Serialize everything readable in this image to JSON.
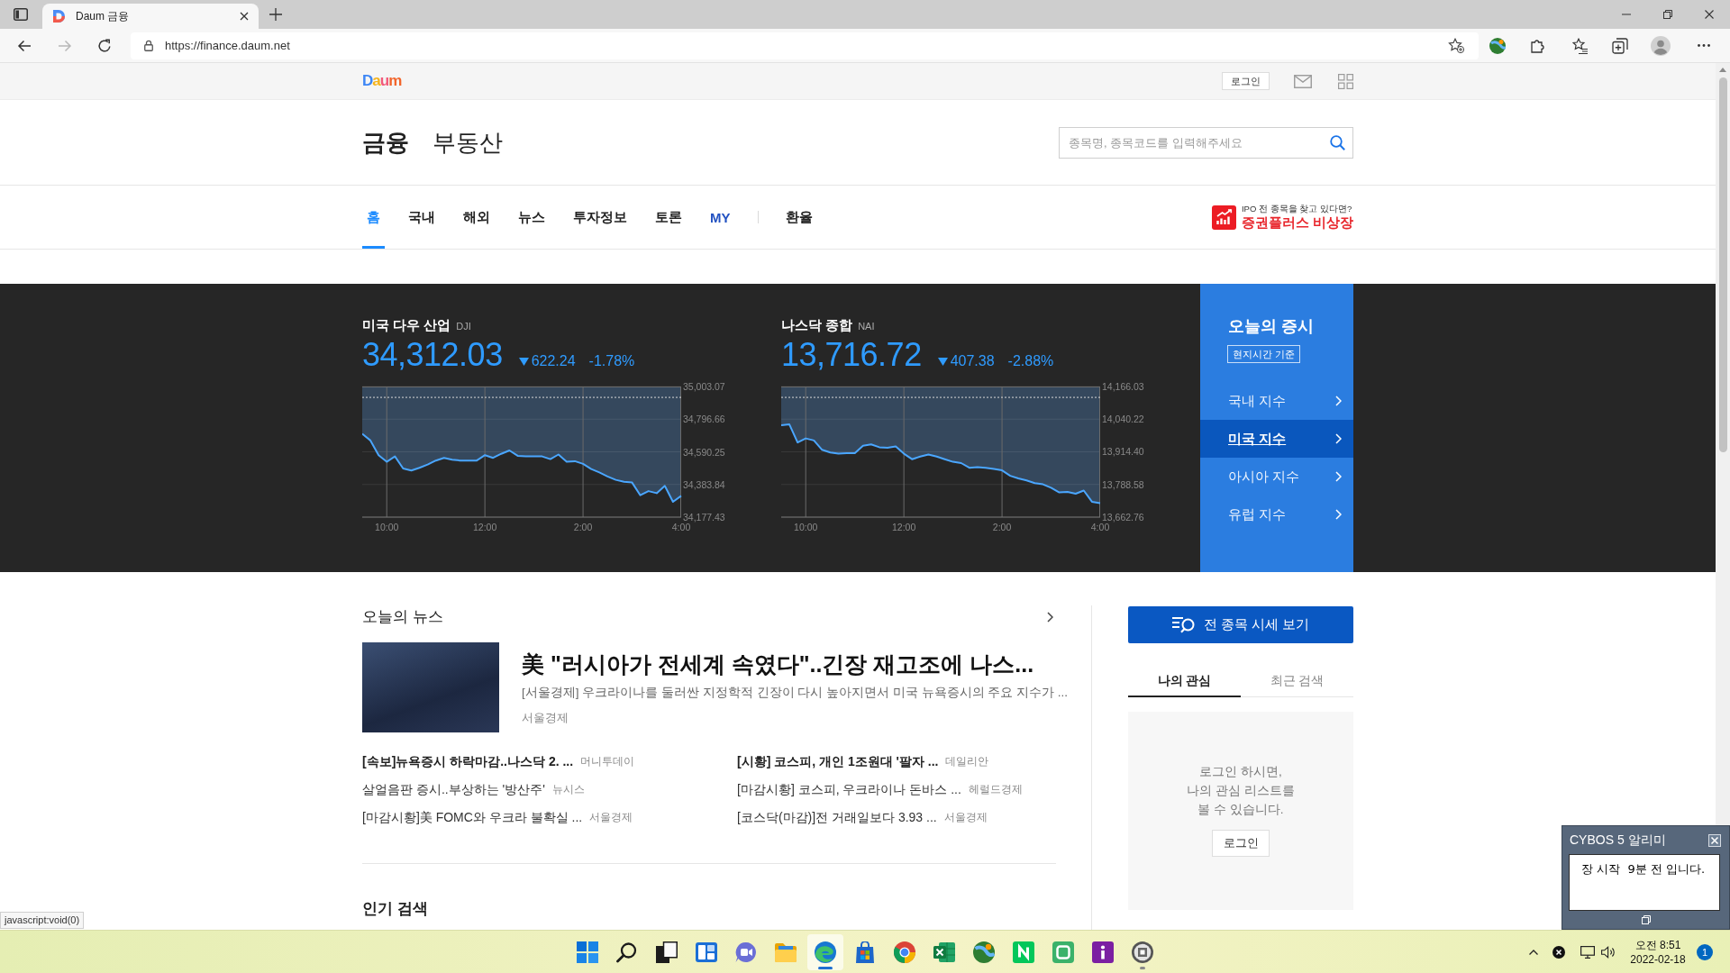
{
  "browser": {
    "tab_title": "Daum 금융",
    "url": "https://finance.daum.net",
    "forward_disabled": true,
    "status_text": "javascript:void(0)"
  },
  "top_bar": {
    "logo": "Daum",
    "login": "로그인"
  },
  "header": {
    "sections": [
      {
        "label": "금융",
        "selected": true
      },
      {
        "label": "부동산",
        "selected": false
      }
    ],
    "search": {
      "placeholder": "종목명, 종목코드를 입력해주세요"
    }
  },
  "nav": {
    "items": [
      {
        "label": "홈",
        "kind": "menu",
        "selected": true
      },
      {
        "label": "국내",
        "kind": "menu",
        "selected": false
      },
      {
        "label": "해외",
        "kind": "menu",
        "selected": false
      },
      {
        "label": "뉴스",
        "kind": "menu",
        "selected": false
      },
      {
        "label": "투자정보",
        "kind": "menu",
        "selected": false
      },
      {
        "label": "토론",
        "kind": "menu",
        "selected": false
      },
      {
        "label": "MY",
        "kind": "personal",
        "selected": false
      }
    ],
    "extra_items": [
      {
        "label": "환율",
        "selected": false
      }
    ]
  },
  "ad": {
    "tagline": "IPO 전 종목을 찾고 있다면?",
    "title": "증권플러스 비상장"
  },
  "indices": [
    {
      "name": "미국 다우 산업",
      "code": "DJI",
      "value": "34,312.03",
      "down": true,
      "change": "622.24",
      "rate": "-1.78%",
      "chart_data": {
        "type": "line",
        "categories": [
          null,
          null,
          null,
          "10:00",
          null,
          null,
          null,
          null,
          null,
          null,
          null,
          null,
          null,
          null,
          null,
          "12:00",
          null,
          null,
          null,
          null,
          null,
          null,
          null,
          null,
          null,
          null,
          null,
          "2:00",
          null,
          null,
          null,
          null,
          null,
          null,
          null,
          null,
          null,
          null,
          null,
          "4:00"
        ],
        "values": [
          34704,
          34662,
          34569,
          34527,
          34561,
          34485,
          34472,
          34489,
          34510,
          34535,
          34552,
          34540,
          34535,
          34535,
          34535,
          34569,
          34552,
          34578,
          34599,
          34565,
          34561,
          34561,
          34561,
          34544,
          34573,
          34527,
          34531,
          34514,
          34481,
          34460,
          34434,
          34413,
          34401,
          34396,
          34316,
          34342,
          34329,
          34375,
          34274,
          34312
        ],
        "ylim": [
          34177.43,
          35003.07
        ],
        "yticks": [
          {
            "value": 35003.07,
            "label": "35,003.07"
          },
          {
            "value": 34796.66,
            "label": "34,796.66"
          },
          {
            "value": 34590.25,
            "label": "34,590.25"
          },
          {
            "value": 34383.84,
            "label": "34,383.84"
          },
          {
            "value": 34177.43,
            "label": "34,177.43"
          }
        ],
        "grid": true,
        "ref_lines": [
          {
            "axis": "y",
            "value": 34934.27
          }
        ]
      }
    },
    {
      "name": "나스닥 종합",
      "code": "NAI",
      "value": "13,716.72",
      "down": true,
      "change": "407.38",
      "rate": "-2.88%",
      "chart_data": {
        "type": "line",
        "categories": [
          null,
          null,
          null,
          "10:00",
          null,
          null,
          null,
          null,
          null,
          null,
          null,
          null,
          null,
          null,
          null,
          "12:00",
          null,
          null,
          null,
          null,
          null,
          null,
          null,
          null,
          null,
          null,
          null,
          "2:00",
          null,
          null,
          null,
          null,
          null,
          null,
          null,
          null,
          null,
          null,
          null,
          "4:00"
        ],
        "values": [
          14017,
          14020,
          13950,
          13966,
          13958,
          13922,
          13912,
          13907,
          13909,
          13909,
          13938,
          13943,
          13932,
          13930,
          13935,
          13907,
          13886,
          13896,
          13904,
          13896,
          13886,
          13876,
          13871,
          13853,
          13855,
          13853,
          13848,
          13843,
          13822,
          13812,
          13804,
          13794,
          13789,
          13776,
          13758,
          13760,
          13753,
          13765,
          13722,
          13717
        ],
        "ylim": [
          13662.76,
          14166.03
        ],
        "yticks": [
          {
            "value": 14166.03,
            "label": "14,166.03"
          },
          {
            "value": 14040.22,
            "label": "14,040.22"
          },
          {
            "value": 13914.4,
            "label": "13,914.40"
          },
          {
            "value": 13788.58,
            "label": "13,788.58"
          },
          {
            "value": 13662.76,
            "label": "13,662.76"
          }
        ],
        "grid": true,
        "ref_lines": [
          {
            "axis": "y",
            "value": 14124.1
          }
        ]
      }
    }
  ],
  "market_panel": {
    "title": "오늘의 증시",
    "note": "현지시간 기준",
    "items": [
      {
        "label": "국내 지수",
        "selected": false
      },
      {
        "label": "미국 지수",
        "selected": true
      },
      {
        "label": "아시아 지수",
        "selected": false
      },
      {
        "label": "유럽 지수",
        "selected": false
      }
    ]
  },
  "news": {
    "title": "오늘의 뉴스",
    "featured": {
      "headline": "美 \"러시아가 전세계 속였다\"..긴장 재고조에 나스...",
      "summary": "[서울경제] 우크라이나를 둘러싼 지정학적 긴장이 다시 높아지면서 미국 뉴욕증시의 주요 지수가 ...",
      "source": "서울경제"
    },
    "items": [
      {
        "title": "[속보]뉴욕증시 하락마감..나스닥 2. ...",
        "source": "머니투데이",
        "bold": true
      },
      {
        "title": "살얼음판 증시..부상하는 '방산주'",
        "source": "뉴시스",
        "bold": false
      },
      {
        "title": "[마감시황]美 FOMC와 우크라 불확실 ...",
        "source": "서울경제",
        "bold": false
      },
      {
        "title": "[시황] 코스피, 개인 1조원대 '팔자 ...",
        "source": "데일리안",
        "bold": true
      },
      {
        "title": "[마감시황] 코스피, 우크라이나 돈바스 ...",
        "source": "헤럴드경제",
        "bold": false
      },
      {
        "title": "[코스닥(마감)]전 거래일보다 3.93 ...",
        "source": "서울경제",
        "bold": false
      }
    ]
  },
  "popular": {
    "title": "인기 검색"
  },
  "sidebar": {
    "all_quotes_button": "전 종목 시세 보기",
    "tabs": [
      {
        "label": "나의 관심",
        "selected": true
      },
      {
        "label": "최근 검색",
        "selected": false
      }
    ],
    "message": "로그인 하시면,\n나의 관심 리스트를\n볼 수 있습니다.",
    "login_button": "로그인"
  },
  "popup": {
    "title": "CYBOS 5 알리미",
    "message": "장 시작  9분 전 입니다."
  },
  "taskbar": {
    "apps": [
      {
        "kind": "start",
        "active": false,
        "running": false
      },
      {
        "kind": "search",
        "active": false,
        "running": false
      },
      {
        "kind": "task_view",
        "active": false,
        "running": false
      },
      {
        "kind": "widgets",
        "active": false,
        "running": false
      },
      {
        "kind": "chat",
        "active": false,
        "running": false
      },
      {
        "kind": "explorer",
        "active": false,
        "running": false
      },
      {
        "kind": "edge",
        "active": true,
        "running": true
      },
      {
        "kind": "store",
        "active": false,
        "running": false
      },
      {
        "kind": "chrome",
        "active": false,
        "running": false
      },
      {
        "kind": "excel",
        "active": false,
        "running": false
      },
      {
        "kind": "globe",
        "active": false,
        "running": false
      },
      {
        "kind": "naver",
        "active": false,
        "running": false
      },
      {
        "kind": "tile_app",
        "active": false,
        "running": false
      },
      {
        "kind": "info_app",
        "active": false,
        "running": false
      },
      {
        "kind": "disc_app",
        "active": false,
        "running": true
      }
    ],
    "clock": {
      "time": "오전 8:51",
      "date": "2022-02-18"
    },
    "notification_count": "1"
  }
}
